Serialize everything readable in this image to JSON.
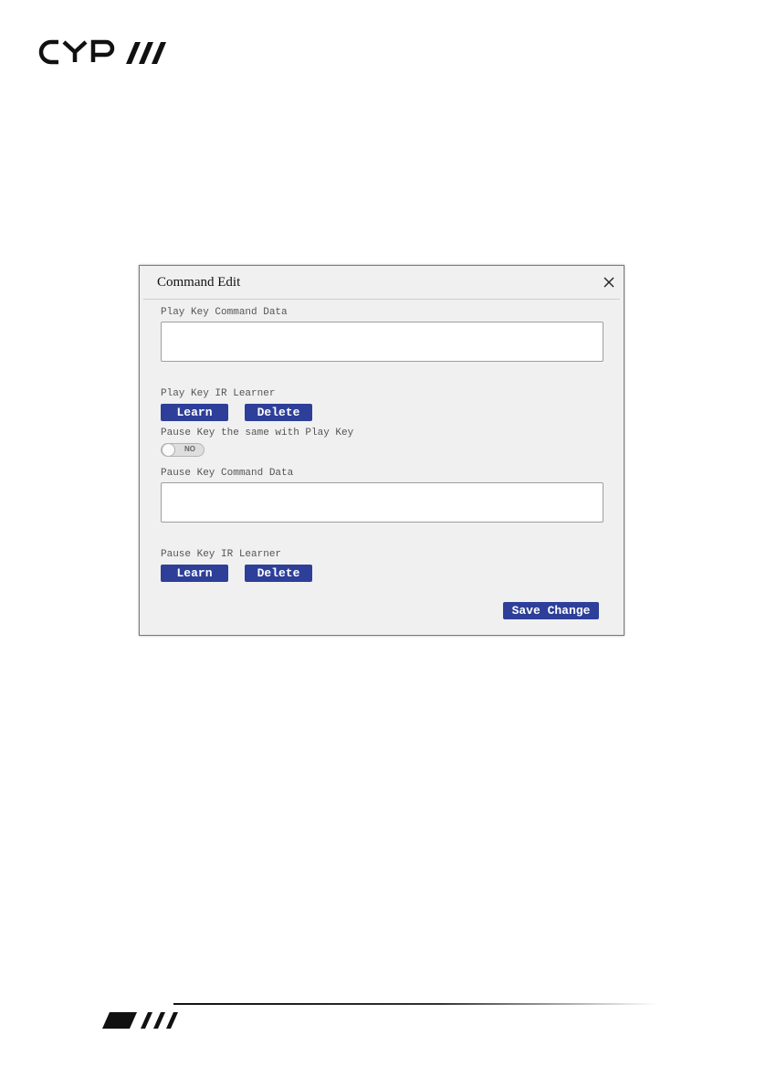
{
  "brand": {
    "logo_text": "CYP"
  },
  "dialog": {
    "title": "Command Edit",
    "play_command_label": "Play Key Command Data",
    "play_command_value": "",
    "play_ir_label": "Play Key IR Learner",
    "play_learn_label": "Learn",
    "play_delete_label": "Delete",
    "pause_same_label": "Pause Key the same with Play Key",
    "pause_same_toggle": "NO",
    "pause_command_label": "Pause Key Command Data",
    "pause_command_value": "",
    "pause_ir_label": "Pause Key IR Learner",
    "pause_learn_label": "Learn",
    "pause_delete_label": "Delete",
    "save_label": "Save Change"
  },
  "colors": {
    "button": "#2d3f99",
    "dialog_bg": "#f0f0f0"
  },
  "icons": {
    "close": "close-icon"
  }
}
